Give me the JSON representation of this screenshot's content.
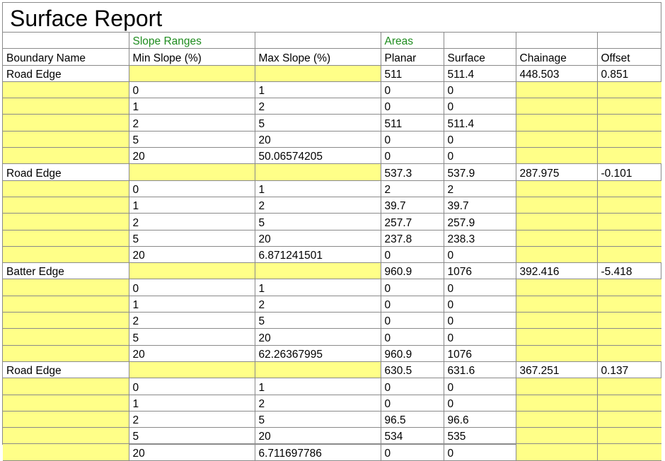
{
  "title": "Surface Report",
  "group_headers": {
    "slope": "Slope Ranges",
    "areas": "Areas"
  },
  "columns": {
    "boundary": "Boundary Name",
    "min_slope": "Min Slope (%)",
    "max_slope": "Max Slope (%)",
    "planar": "Planar",
    "surface": "Surface",
    "chainage": "Chainage",
    "offset": "Offset"
  },
  "colors": {
    "highlight": "#ffff88",
    "group_header": "#1e8c1e",
    "grid": "#8a8a8a"
  },
  "boundaries": [
    {
      "name": "Road Edge",
      "planar": "511",
      "surface": "511.4",
      "chainage": "448.503",
      "offset": "0.851",
      "ranges": [
        {
          "min": "0",
          "max": "1",
          "planar": "0",
          "surface": "0"
        },
        {
          "min": "1",
          "max": "2",
          "planar": "0",
          "surface": "0"
        },
        {
          "min": "2",
          "max": "5",
          "planar": "511",
          "surface": "511.4"
        },
        {
          "min": "5",
          "max": "20",
          "planar": "0",
          "surface": "0"
        },
        {
          "min": "20",
          "max": "50.06574205",
          "planar": "0",
          "surface": "0"
        }
      ]
    },
    {
      "name": "Road Edge",
      "planar": "537.3",
      "surface": "537.9",
      "chainage": "287.975",
      "offset": "-0.101",
      "ranges": [
        {
          "min": "0",
          "max": "1",
          "planar": "2",
          "surface": "2"
        },
        {
          "min": "1",
          "max": "2",
          "planar": "39.7",
          "surface": "39.7"
        },
        {
          "min": "2",
          "max": "5",
          "planar": "257.7",
          "surface": "257.9"
        },
        {
          "min": "5",
          "max": "20",
          "planar": "237.8",
          "surface": "238.3"
        },
        {
          "min": "20",
          "max": "6.871241501",
          "planar": "0",
          "surface": "0"
        }
      ]
    },
    {
      "name": "Batter Edge",
      "planar": "960.9",
      "surface": "1076",
      "chainage": "392.416",
      "offset": "-5.418",
      "ranges": [
        {
          "min": "0",
          "max": "1",
          "planar": "0",
          "surface": "0"
        },
        {
          "min": "1",
          "max": "2",
          "planar": "0",
          "surface": "0"
        },
        {
          "min": "2",
          "max": "5",
          "planar": "0",
          "surface": "0"
        },
        {
          "min": "5",
          "max": "20",
          "planar": "0",
          "surface": "0"
        },
        {
          "min": "20",
          "max": "62.26367995",
          "planar": "960.9",
          "surface": "1076"
        }
      ]
    },
    {
      "name": "Road Edge",
      "planar": "630.5",
      "surface": "631.6",
      "chainage": "367.251",
      "offset": "0.137",
      "ranges": [
        {
          "min": "0",
          "max": "1",
          "planar": "0",
          "surface": "0"
        },
        {
          "min": "1",
          "max": "2",
          "planar": "0",
          "surface": "0"
        },
        {
          "min": "2",
          "max": "5",
          "planar": "96.5",
          "surface": "96.6"
        },
        {
          "min": "5",
          "max": "20",
          "planar": "534",
          "surface": "535"
        },
        {
          "min": "20",
          "max": "6.711697786",
          "planar": "0",
          "surface": "0"
        }
      ]
    }
  ]
}
